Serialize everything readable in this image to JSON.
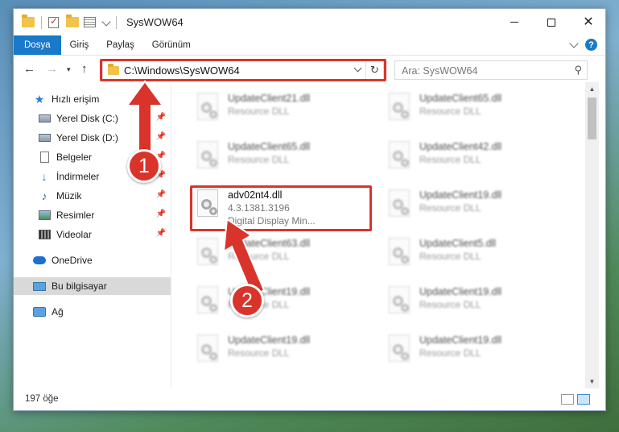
{
  "window": {
    "title": "SysWOW64"
  },
  "ribbon": {
    "tabs": [
      "Dosya",
      "Giriş",
      "Paylaş",
      "Görünüm"
    ],
    "help": "?"
  },
  "navigation": {
    "address": "C:\\Windows\\SysWOW64",
    "search_placeholder": "Ara: SysWOW64"
  },
  "sidebar": {
    "quick_access": "Hızlı erişim",
    "items": [
      {
        "label": "Yerel Disk (C:)",
        "icon": "drive-icon"
      },
      {
        "label": "Yerel Disk (D:)",
        "icon": "drive-icon"
      },
      {
        "label": "Belgeler",
        "icon": "documents-icon"
      },
      {
        "label": "İndirmeler",
        "icon": "download-icon"
      },
      {
        "label": "Müzik",
        "icon": "music-icon"
      },
      {
        "label": "Resimler",
        "icon": "pictures-icon"
      },
      {
        "label": "Videolar",
        "icon": "videos-icon"
      }
    ],
    "onedrive": "OneDrive",
    "this_pc": "Bu bilgisayar",
    "network": "Ağ"
  },
  "files": {
    "left_column": [
      {
        "name": "UpdateClient21.dll",
        "type": "Resource DLL"
      },
      {
        "name": "UpdateClient65.dll",
        "type": "Resource DLL"
      },
      {
        "name": "adv02nt4.dll",
        "version": "4.3.1381.3196",
        "description": "Digital Display Min..."
      },
      {
        "name": "UpdateClient63.dll",
        "type": "Resource DLL"
      },
      {
        "name": "UpdateClient19.dll",
        "type": "Resource DLL"
      },
      {
        "name": "UpdateClient19.dll",
        "type": "Resource DLL"
      }
    ],
    "right_column": [
      {
        "name": "UpdateClient65.dll",
        "type": "Resource DLL"
      },
      {
        "name": "UpdateClient42.dll",
        "type": "Resource DLL"
      },
      {
        "name": "UpdateClient19.dll",
        "type": "Resource DLL"
      },
      {
        "name": "UpdateClient5.dll",
        "type": "Resource DLL"
      },
      {
        "name": "UpdateClient19.dll",
        "type": "Resource DLL"
      },
      {
        "name": "UpdateClient19.dll",
        "type": "Resource DLL"
      }
    ]
  },
  "status": {
    "count": "197 öğe"
  },
  "annotations": {
    "step1": "1",
    "step2": "2",
    "color": "#d9342b"
  }
}
